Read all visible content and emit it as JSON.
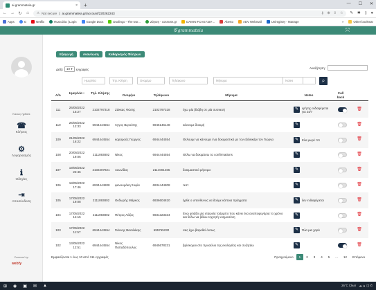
{
  "browser": {
    "tab_title": "ai.grammateia.gr",
    "insecure_label": "Not secure",
    "url": "ai.grammateia.gr/account/220262243",
    "bookmarks": [
      "Apps",
      "G",
      "Netflix",
      "Πωσούλα | Login",
      "Google Docs",
      "Duolingo - The wor...",
      "Ζύγιση - cosmote.gr",
      "DAIKIN FCAG71B+...",
      "Aberto",
      "ADV Webmail",
      "Uniregistry - Manage"
    ],
    "bookmarks_more": "»",
    "other_bookmarks": "Other bookmar"
  },
  "app": {
    "logo_text": "grammateia",
    "sidebar": {
      "welcome": "Καλώς ήρθατε",
      "items": [
        {
          "label": "Κλήσεις",
          "icon": "phone-icon",
          "glyph": "☎"
        },
        {
          "label": "Λογαριασμός",
          "icon": "gear-icon",
          "glyph": "⚙"
        },
        {
          "label": "Οδηγίες",
          "icon": "info-icon",
          "glyph": "ℹ"
        },
        {
          "label": "Αποσύνδεση",
          "icon": "logout-icon",
          "glyph": "⇥"
        }
      ],
      "powered_by": "Powered by:",
      "powered_logo": "webfy"
    },
    "toolbar": {
      "export_label": "Εξαγωγή",
      "refresh_label": "Ανανέωση",
      "clear_filters_label": "Καθαρισμός Φίλτρων"
    },
    "show": {
      "prefix": "Δείξε",
      "value": "10",
      "suffix": "εγγραφές"
    },
    "search_label": "Αναζήτηση:",
    "filters": {
      "date": "Ημερ/νία",
      "phone": "Τηλ. Κλήση",
      "name": "Ονομ/μο",
      "tel": "Τηλέφωνο",
      "message": "Μήνυμα",
      "notes": "Notes"
    },
    "columns": {
      "aa": "Α/Α",
      "date": "Ημερ/νία",
      "phone": "Τηλ. Κλήσης",
      "name": "Ονομ/μο",
      "tel": "Τηλέφωνο",
      "message": "Μήνυμα",
      "notes": "Notes",
      "callback": "Call back"
    },
    "rows": [
      {
        "aa": "111",
        "date": "26/05/2022 15:27",
        "phone": "2102797318",
        "name": "Ζάκκας Φώτης",
        "tel": "2102797318",
        "message": "έχω μία βλάβη σε μία συσκευή",
        "notes": "ερήτης ενδιαφέρεται για 24/7",
        "callback": true
      },
      {
        "aa": "110",
        "date": "26/05/2022 12:33",
        "phone": "6944444554",
        "name": "Άγγος Βερούτης",
        "tel": "6945146148",
        "message": "κάνουμε δοκιμή",
        "notes": "",
        "callback": false
      },
      {
        "aa": "109",
        "date": "21/05/2022 16:22",
        "phone": "6944444554",
        "name": "καραρούς Γιώργος",
        "tel": "6944444554",
        "message": "Θέλουμε να κάνουμε ένα δοκιμαστικό με τον εξιδεικάρι τον Γιώργο",
        "notes": "Ελα μωρέ ππ",
        "callback": false
      },
      {
        "aa": "108",
        "date": "20/05/2022 19:06",
        "phone": "2111893802",
        "name": "Νίκος",
        "tel": "6944444554",
        "message": "Θέλω να δοκιμάσω τα confirmations",
        "notes": "",
        "callback": false
      },
      {
        "aa": "107",
        "date": "19/05/2022 22:46",
        "phone": "2102207821",
        "name": "Λεωνίδας",
        "tel": "2114001465",
        "message": "δοκιμαστικό μήνυμα",
        "notes": "",
        "callback": false
      },
      {
        "aa": "106",
        "date": "18/05/2022 17:46",
        "phone": "6934444808",
        "name": "φανουράκη Σοφία",
        "tel": "6934444808",
        "message": "τεστ",
        "notes": "",
        "callback": false
      },
      {
        "aa": "105",
        "date": "17/05/2022 19:08",
        "phone": "2111893802",
        "name": "Θεδωρής Μάρκος",
        "tel": "6936604810",
        "message": "ήρθε ο υπεύθυνος να δούμε κάποια πράγματα",
        "notes": "δεν ενδιαφέρεται",
        "callback": false
      },
      {
        "aa": "104",
        "date": "17/05/2022 14:15",
        "phone": "2111893802",
        "name": "Πέτρος Λάζος",
        "tel": "6931323334",
        "message": "Ενώ φτιάξει μία εταιρεία τοάρμπο που κάνει ένα αναποφυγάρια το χρόνο και θέλω να βάλω τεχνητή νοημοσύνη",
        "notes": "",
        "callback": false
      },
      {
        "aa": "103",
        "date": "17/05/2022 11:57",
        "phone": "6944444554",
        "name": "Γιάννης Βασιλάκης",
        "tel": "695765230",
        "message": "σας έχω βαρεθεί όντως",
        "notes": "Όλα μια χαρά",
        "callback": false
      },
      {
        "aa": "102",
        "date": "13/05/2022 12:51",
        "phone": "6944444554",
        "name": "Νίκος Παπαδόπουλος",
        "tel": "6945678231",
        "message": "βρίσκομαι στο προαύλιο της εκκλησίας και συζητάω",
        "notes": "",
        "callback": true
      }
    ],
    "footer_info": "Εμφανίζονται 1 έως 10 από 111 εγγραφές",
    "pagination": {
      "prev": "Προηγούμενο",
      "pages": [
        "1",
        "2",
        "3",
        "4",
        "5",
        "...",
        "12"
      ],
      "active_page": "1",
      "next": "Επόμενο"
    }
  },
  "taskbar": {
    "weather": "26°C Clear"
  },
  "colors": {
    "brand": "#3c8a77",
    "navy": "#1d3047",
    "delete": "#e0262f"
  }
}
